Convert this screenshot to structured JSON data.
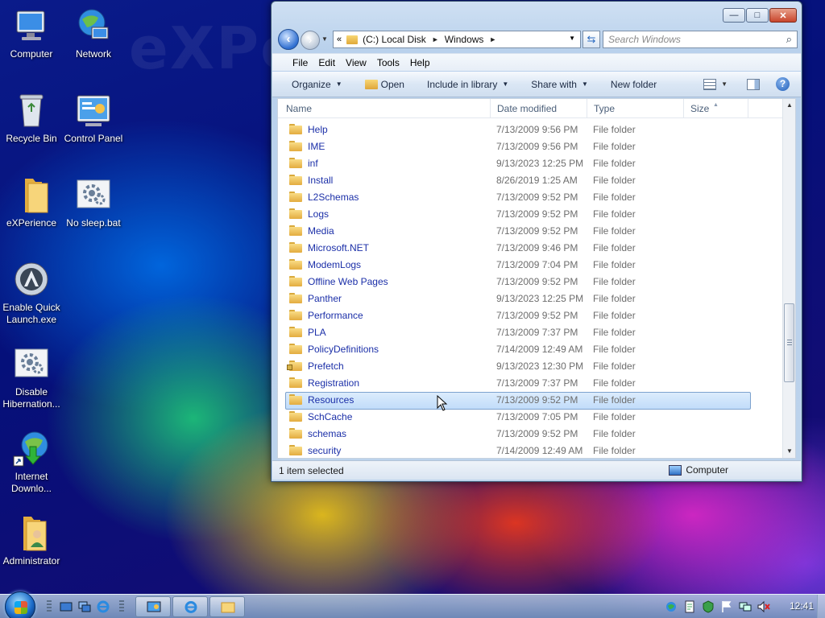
{
  "desktop": {
    "watermark": "eXPe",
    "icons": [
      {
        "label": "Computer"
      },
      {
        "label": "Network"
      },
      {
        "label": "Recycle Bin"
      },
      {
        "label": "Control Panel"
      },
      {
        "label": "eXPerience"
      },
      {
        "label": "No sleep.bat"
      },
      {
        "label": "Enable Quick Launch.exe"
      },
      {
        "label": "Disable Hibernation..."
      },
      {
        "label": "Internet Downlo..."
      },
      {
        "label": "Administrator"
      }
    ]
  },
  "window": {
    "caption_buttons": {
      "minimize": "—",
      "maximize": "□",
      "close": "✕"
    },
    "address": {
      "prefix": "«",
      "crumbs": [
        "(C:) Local Disk",
        "Windows"
      ],
      "separator": "►"
    },
    "search_placeholder": "Search Windows",
    "menu": [
      {
        "label": "File"
      },
      {
        "label": "Edit"
      },
      {
        "label": "View"
      },
      {
        "label": "Tools"
      },
      {
        "label": "Help"
      }
    ],
    "commands": {
      "organize": "Organize",
      "open": "Open",
      "include": "Include in library",
      "share": "Share with",
      "new_folder": "New folder",
      "help": "?"
    },
    "columns": {
      "name": "Name",
      "date": "Date modified",
      "type": "Type",
      "size": "Size"
    },
    "rows": [
      {
        "name": "Help",
        "date": "7/13/2009 9:56 PM",
        "type": "File folder"
      },
      {
        "name": "IME",
        "date": "7/13/2009 9:56 PM",
        "type": "File folder"
      },
      {
        "name": "inf",
        "date": "9/13/2023 12:25 PM",
        "type": "File folder"
      },
      {
        "name": "Install",
        "date": "8/26/2019 1:25 AM",
        "type": "File folder"
      },
      {
        "name": "L2Schemas",
        "date": "7/13/2009 9:52 PM",
        "type": "File folder"
      },
      {
        "name": "Logs",
        "date": "7/13/2009 9:52 PM",
        "type": "File folder"
      },
      {
        "name": "Media",
        "date": "7/13/2009 9:52 PM",
        "type": "File folder"
      },
      {
        "name": "Microsoft.NET",
        "date": "7/13/2009 9:46 PM",
        "type": "File folder"
      },
      {
        "name": "ModemLogs",
        "date": "7/13/2009 7:04 PM",
        "type": "File folder"
      },
      {
        "name": "Offline Web Pages",
        "date": "7/13/2009 9:52 PM",
        "type": "File folder"
      },
      {
        "name": "Panther",
        "date": "9/13/2023 12:25 PM",
        "type": "File folder"
      },
      {
        "name": "Performance",
        "date": "7/13/2009 9:52 PM",
        "type": "File folder"
      },
      {
        "name": "PLA",
        "date": "7/13/2009 7:37 PM",
        "type": "File folder"
      },
      {
        "name": "PolicyDefinitions",
        "date": "7/14/2009 12:49 AM",
        "type": "File folder"
      },
      {
        "name": "Prefetch",
        "date": "9/13/2023 12:30 PM",
        "type": "File folder"
      },
      {
        "name": "Registration",
        "date": "7/13/2009 7:37 PM",
        "type": "File folder"
      },
      {
        "name": "Resources",
        "date": "7/13/2009 9:52 PM",
        "type": "File folder"
      },
      {
        "name": "SchCache",
        "date": "7/13/2009 7:05 PM",
        "type": "File folder"
      },
      {
        "name": "schemas",
        "date": "7/13/2009 9:52 PM",
        "type": "File folder"
      },
      {
        "name": "security",
        "date": "7/14/2009 12:49 AM",
        "type": "File folder"
      }
    ],
    "selected_row": "Resources",
    "status": {
      "selection": "1 item selected",
      "location": "Computer"
    }
  },
  "taskbar": {
    "clock": "12:41"
  },
  "colors": {
    "link_blue": "#1b2fa8",
    "selection": "#c1dcfa",
    "selection_border": "#7da2ce",
    "taskbar": "#8aa6c8"
  }
}
